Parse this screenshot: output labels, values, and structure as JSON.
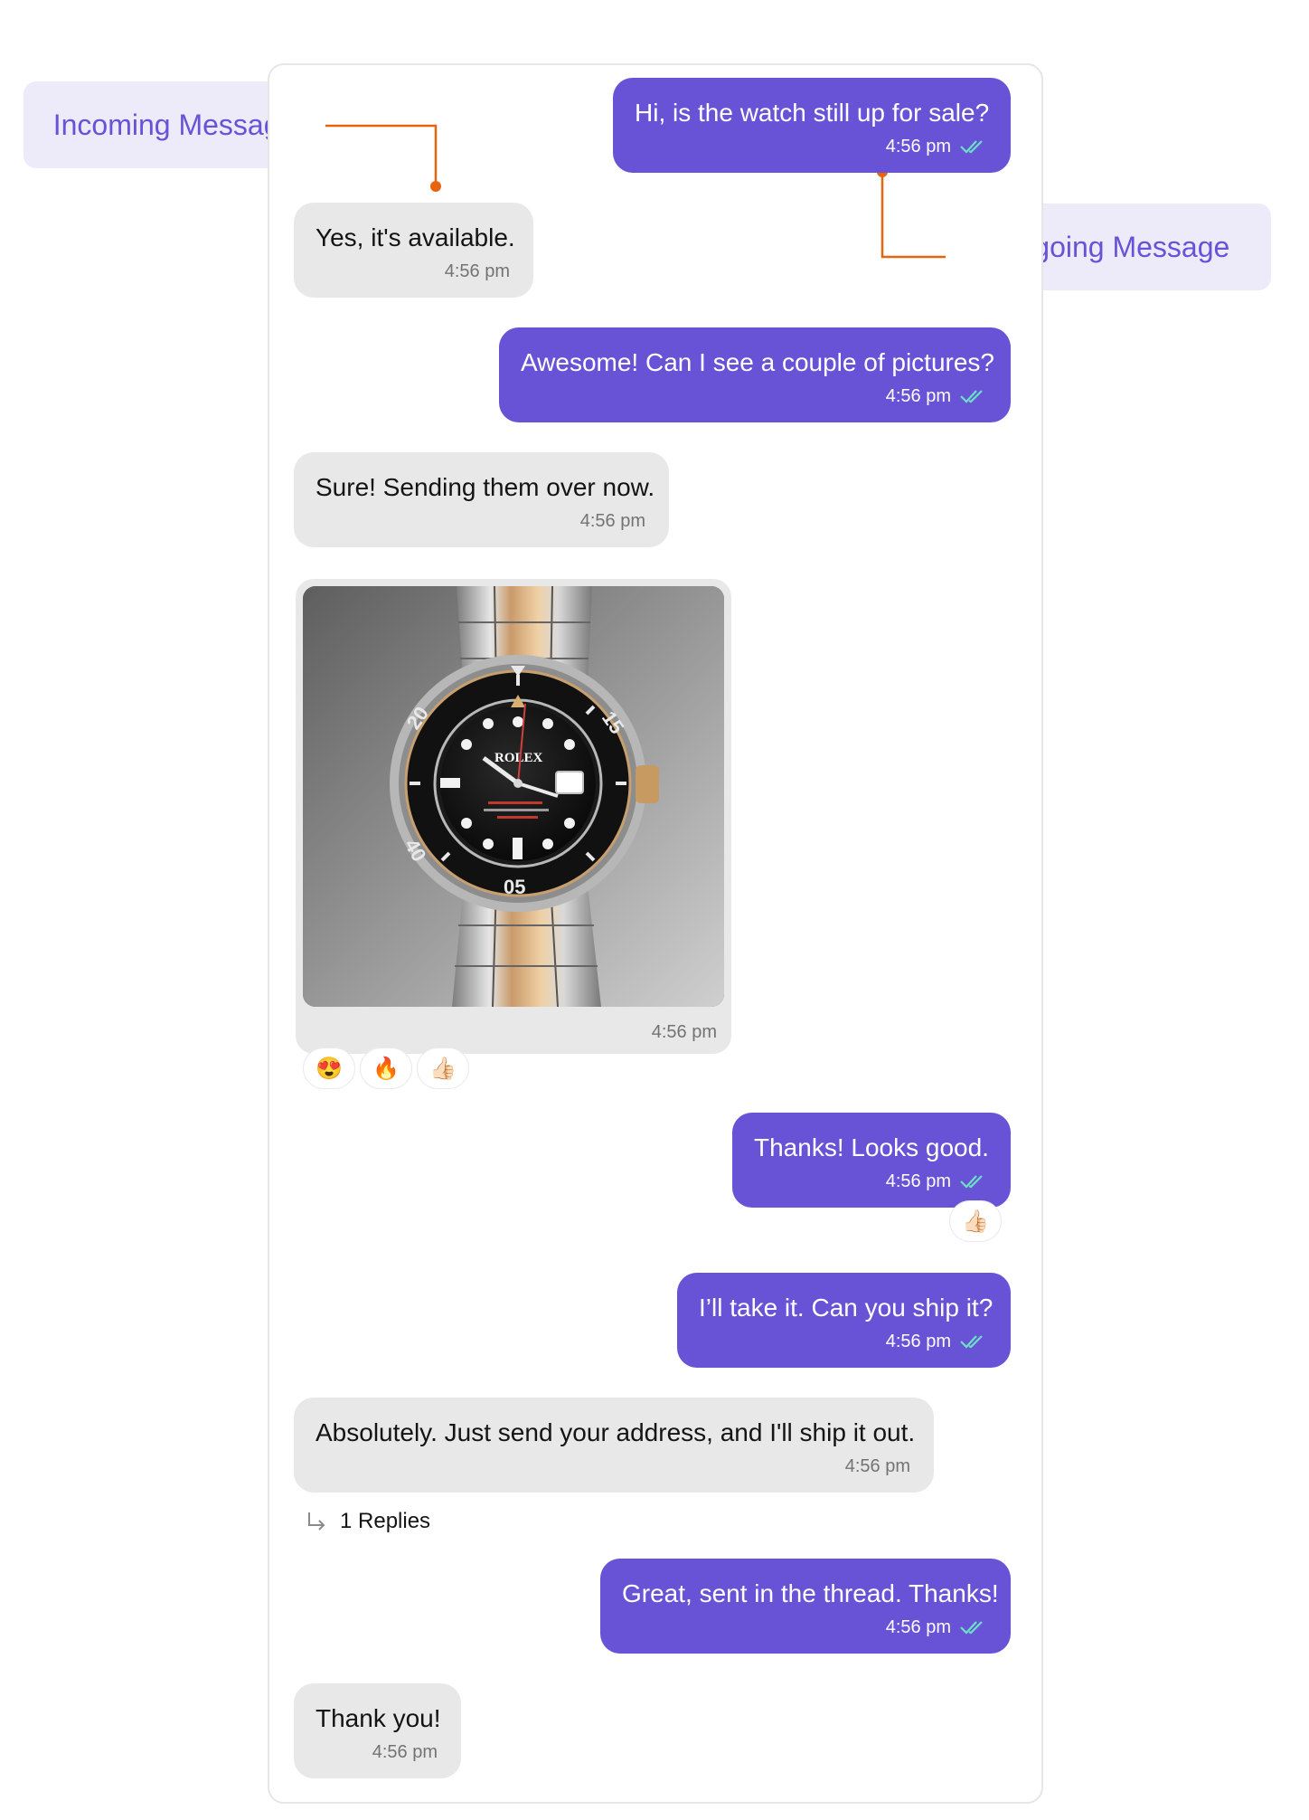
{
  "labels": {
    "incoming": "Incoming Message",
    "outgoing": "Outgoing Message"
  },
  "messages": [
    {
      "direction": "outgoing",
      "text": "Hi, is the watch still up for sale?",
      "time": "4:56 pm",
      "status": "read"
    },
    {
      "direction": "incoming",
      "text": "Yes, it's available.",
      "time": "4:56 pm"
    },
    {
      "direction": "outgoing",
      "text": "Awesome! Can I see a couple of pictures?",
      "time": "4:56 pm",
      "status": "read"
    },
    {
      "direction": "incoming",
      "text": "Sure! Sending them over now.",
      "time": "4:56 pm"
    },
    {
      "direction": "incoming",
      "type": "image",
      "time": "4:56 pm",
      "reactions": [
        "😍",
        "🔥",
        "👍🏻"
      ]
    },
    {
      "direction": "outgoing",
      "text": "Thanks! Looks good.",
      "time": "4:56 pm",
      "status": "read",
      "reactions": [
        "👍🏻"
      ]
    },
    {
      "direction": "outgoing",
      "text": "I’ll take it. Can you ship it?",
      "time": "4:56 pm",
      "status": "read"
    },
    {
      "direction": "incoming",
      "text": "Absolutely. Just send your address, and I'll ship it out.",
      "time": "4:56 pm",
      "replies": "1 Replies"
    },
    {
      "direction": "outgoing",
      "text": "Great, sent in the thread. Thanks!",
      "time": "4:56 pm",
      "status": "read"
    },
    {
      "direction": "incoming",
      "text": "Thank you!",
      "time": "4:56 pm"
    }
  ],
  "image": {
    "dial_numbers": [
      "20",
      "40",
      "05",
      "15"
    ],
    "brand": "ROLEX"
  },
  "colors": {
    "outgoing_bubble": "#6852D6",
    "incoming_bubble": "#E8E8E8",
    "read_ticks": "#6CE0C6",
    "label_bg": "#EDEBFA",
    "connector": "#E8650F"
  }
}
